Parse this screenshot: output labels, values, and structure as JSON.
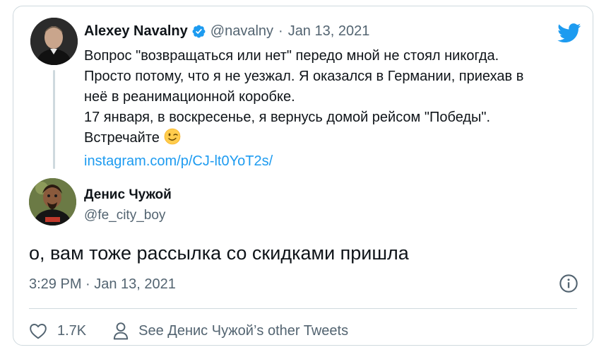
{
  "quoted_tweet": {
    "author_name": "Alexey Navalny",
    "author_handle": "@navalny",
    "separator": "·",
    "date": "Jan 13, 2021",
    "lines": [
      "Вопрос \"возвращаться или нет\" передо мной не стоял никогда.",
      "Просто потому, что я не уезжал. Я оказался в Германии, приехав в",
      "неё в реанимационной коробке.",
      "17 января, в воскресенье, я вернусь домой рейсом \"Победы\".",
      "Встречайте"
    ],
    "emoji": "winking-face",
    "link": "instagram.com/p/CJ-lt0YoT2s/"
  },
  "reply_tweet": {
    "author_name": "Денис Чужой",
    "author_handle": "@fe_city_boy",
    "text": "о, вам тоже рассылка со скидками пришла",
    "timestamp": "3:29 PM · Jan 13, 2021"
  },
  "actions": {
    "like_count": "1.7K",
    "profile_link": "See Денис Чужой’s other Tweets"
  },
  "colors": {
    "brand": "#1d9bf0",
    "text": "#0f1419",
    "muted": "#536471",
    "border": "#cfd9de"
  },
  "icons": [
    "twitter-bird-icon",
    "verified-badge-icon",
    "info-icon",
    "heart-icon",
    "person-icon"
  ]
}
